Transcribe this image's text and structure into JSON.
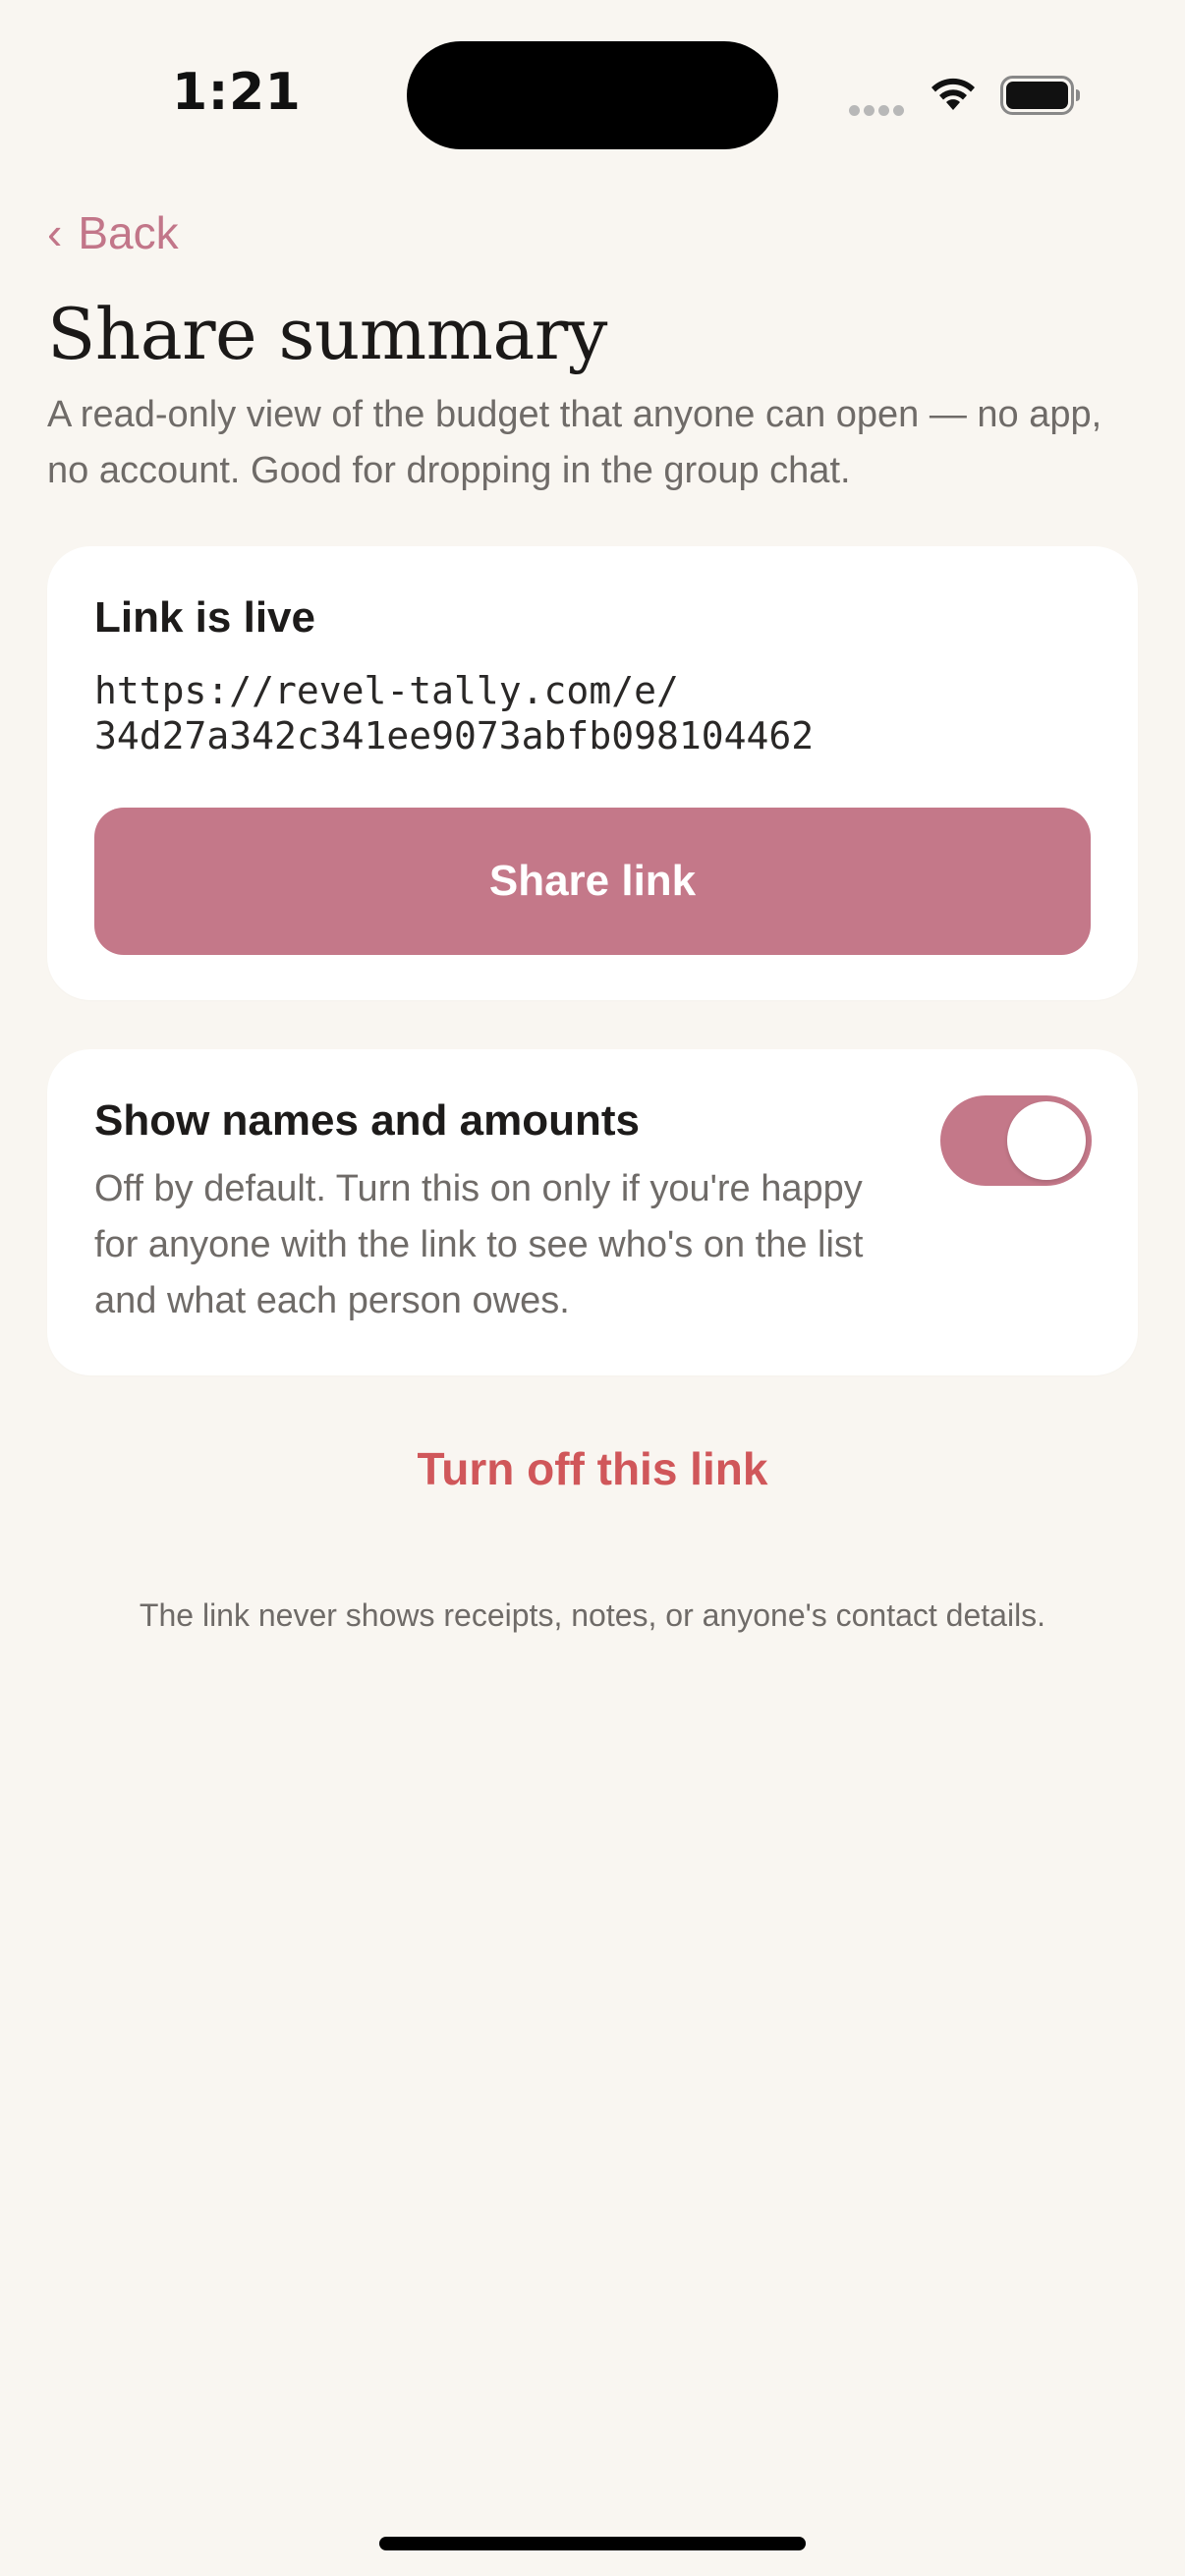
{
  "status_bar": {
    "time": "1:21"
  },
  "nav": {
    "back_label": "Back"
  },
  "header": {
    "title": "Share summary",
    "subtitle": "A read-only view of the budget that anyone can open — no app, no account. Good for dropping in the group chat."
  },
  "link_card": {
    "title": "Link is live",
    "url_line1": "https://revel-tally.com/e/",
    "url_line2": "34d27a342c341ee9073abfb098104462",
    "share_button_label": "Share link"
  },
  "privacy_toggle": {
    "title": "Show names and amounts",
    "description": "Off by default. Turn this on only if you're happy for anyone with the link to see who's on the list and what each person owes.",
    "enabled": true
  },
  "actions": {
    "turn_off_label": "Turn off this link"
  },
  "footer": {
    "note": "The link never shows receipts, notes, or anyone's contact details."
  },
  "colors": {
    "accent": "#c47889",
    "destructive": "#d0575a",
    "background": "#f9f6f1",
    "card": "#ffffff",
    "muted_text": "#6f6b68"
  },
  "icons": {
    "back": "chevron-left-icon",
    "wifi": "wifi-icon",
    "battery": "battery-icon",
    "signal": "cellular-signal-icon"
  }
}
